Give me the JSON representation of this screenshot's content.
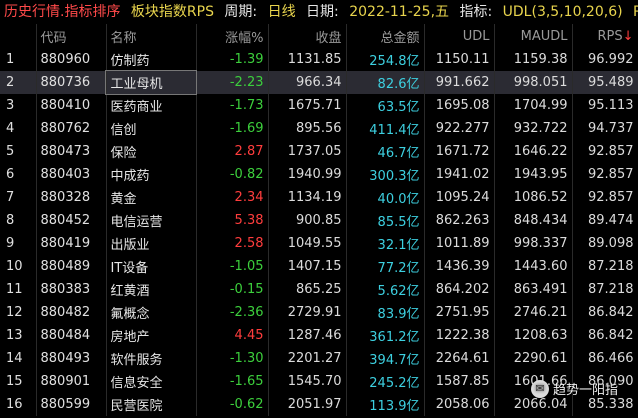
{
  "header": {
    "title": "历史行情.指标排序",
    "board": "板块指数RPS",
    "period_label": "周期:",
    "period_value": "日线",
    "date_label": "日期:",
    "date_value": "2022-11-25,五",
    "indicator_label": "指标:",
    "indicator_value": "UDL(3,5,10,20,6)",
    "overflow": "RP"
  },
  "columns": [
    "",
    "代码",
    "名称",
    "涨幅%",
    "收盘",
    "总金额",
    "UDL",
    "MAUDL",
    "RPS"
  ],
  "sort_arrow": "↓",
  "rows": [
    {
      "idx": "1",
      "code": "880960",
      "name": "仿制药",
      "chg": "-1.39",
      "close": "1131.85",
      "amount": "254.8亿",
      "udl": "1150.11",
      "maudl": "1159.38",
      "rps": "96.992"
    },
    {
      "idx": "2",
      "code": "880736",
      "name": "工业母机",
      "chg": "-2.23",
      "close": "966.34",
      "amount": "82.6亿",
      "udl": "991.662",
      "maudl": "998.051",
      "rps": "95.489"
    },
    {
      "idx": "3",
      "code": "880410",
      "name": "医药商业",
      "chg": "-1.73",
      "close": "1675.71",
      "amount": "63.5亿",
      "udl": "1695.08",
      "maudl": "1704.99",
      "rps": "95.113"
    },
    {
      "idx": "4",
      "code": "880762",
      "name": "信创",
      "chg": "-1.69",
      "close": "895.56",
      "amount": "411.4亿",
      "udl": "922.277",
      "maudl": "932.722",
      "rps": "94.737"
    },
    {
      "idx": "5",
      "code": "880473",
      "name": "保险",
      "chg": "2.87",
      "close": "1737.05",
      "amount": "46.7亿",
      "udl": "1671.72",
      "maudl": "1646.22",
      "rps": "92.857"
    },
    {
      "idx": "6",
      "code": "880403",
      "name": "中成药",
      "chg": "-0.82",
      "close": "1940.99",
      "amount": "300.3亿",
      "udl": "1941.02",
      "maudl": "1943.95",
      "rps": "92.857"
    },
    {
      "idx": "7",
      "code": "880328",
      "name": "黄金",
      "chg": "2.34",
      "close": "1134.19",
      "amount": "40.0亿",
      "udl": "1095.24",
      "maudl": "1086.52",
      "rps": "92.857"
    },
    {
      "idx": "8",
      "code": "880452",
      "name": "电信运营",
      "chg": "5.38",
      "close": "900.85",
      "amount": "85.5亿",
      "udl": "862.263",
      "maudl": "848.434",
      "rps": "89.474"
    },
    {
      "idx": "9",
      "code": "880419",
      "name": "出版业",
      "chg": "2.58",
      "close": "1049.55",
      "amount": "32.1亿",
      "udl": "1011.89",
      "maudl": "998.337",
      "rps": "89.098"
    },
    {
      "idx": "10",
      "code": "880489",
      "name": "IT设备",
      "chg": "-1.05",
      "close": "1407.15",
      "amount": "77.2亿",
      "udl": "1436.39",
      "maudl": "1443.60",
      "rps": "87.218"
    },
    {
      "idx": "11",
      "code": "880383",
      "name": "红黄酒",
      "chg": "-0.15",
      "close": "865.25",
      "amount": "5.62亿",
      "udl": "864.202",
      "maudl": "863.491",
      "rps": "87.218"
    },
    {
      "idx": "12",
      "code": "880482",
      "name": "氟概念",
      "chg": "-2.36",
      "close": "2729.91",
      "amount": "83.9亿",
      "udl": "2751.95",
      "maudl": "2746.21",
      "rps": "86.842"
    },
    {
      "idx": "13",
      "code": "880484",
      "name": "房地产",
      "chg": "4.45",
      "close": "1287.46",
      "amount": "361.2亿",
      "udl": "1222.38",
      "maudl": "1208.63",
      "rps": "86.842"
    },
    {
      "idx": "14",
      "code": "880493",
      "name": "软件服务",
      "chg": "-1.30",
      "close": "2201.27",
      "amount": "394.7亿",
      "udl": "2264.61",
      "maudl": "2290.61",
      "rps": "86.466"
    },
    {
      "idx": "15",
      "code": "880901",
      "name": "信息安全",
      "chg": "-1.65",
      "close": "1545.70",
      "amount": "245.2亿",
      "udl": "1587.85",
      "maudl": "1601.66",
      "rps": "86.090"
    },
    {
      "idx": "16",
      "code": "880599",
      "name": "民营医院",
      "chg": "-0.62",
      "close": "2051.97",
      "amount": "113.9亿",
      "udl": "2058.06",
      "maudl": "2066.04",
      "rps": "85.338"
    }
  ],
  "selected_row": 1,
  "watermark": {
    "text": "趋势一阳指",
    "icon": "wechat-icon"
  }
}
